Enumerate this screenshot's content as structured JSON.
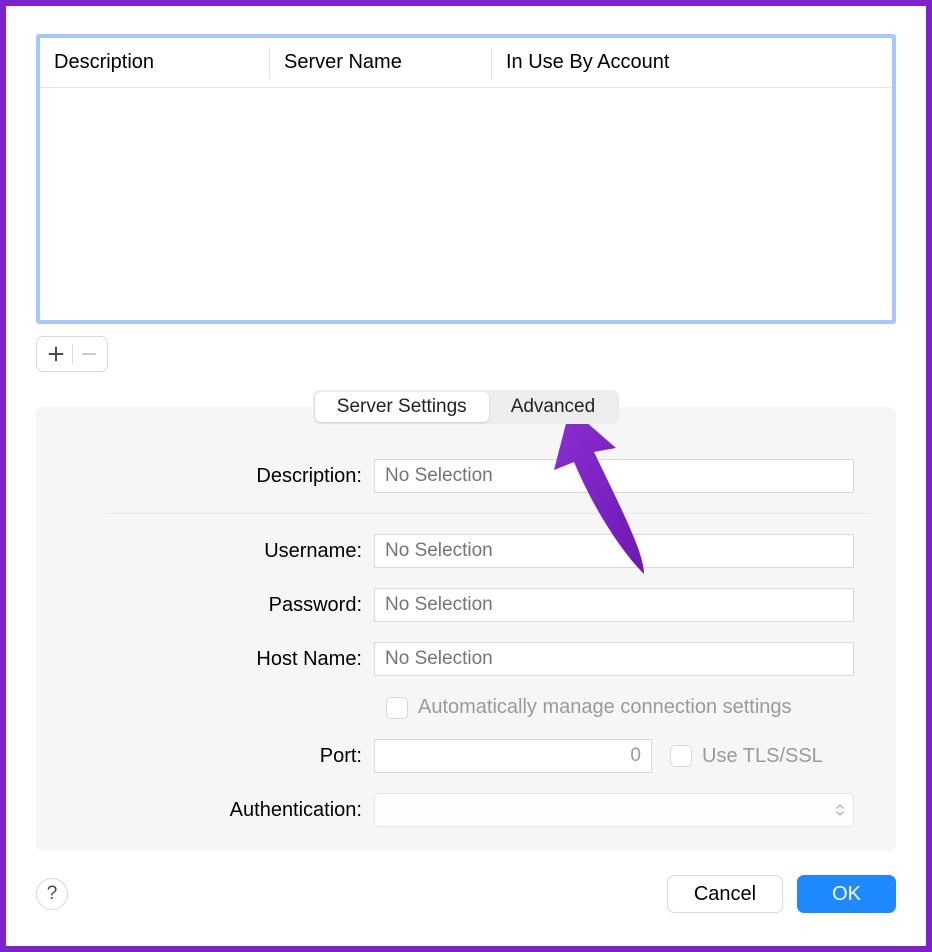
{
  "table": {
    "headers": [
      "Description",
      "Server Name",
      "In Use By Account"
    ]
  },
  "toolbar": {
    "add_label": "+",
    "remove_label": "−"
  },
  "tabs": {
    "server_settings": "Server Settings",
    "advanced": "Advanced"
  },
  "form": {
    "description_label": "Description:",
    "description_placeholder": "No Selection",
    "username_label": "Username:",
    "username_placeholder": "No Selection",
    "password_label": "Password:",
    "password_placeholder": "No Selection",
    "hostname_label": "Host Name:",
    "hostname_placeholder": "No Selection",
    "auto_manage_label": "Automatically manage connection settings",
    "port_label": "Port:",
    "port_value": "0",
    "tls_label": "Use TLS/SSL",
    "auth_label": "Authentication:"
  },
  "footer": {
    "help_label": "?",
    "cancel_label": "Cancel",
    "ok_label": "OK"
  }
}
